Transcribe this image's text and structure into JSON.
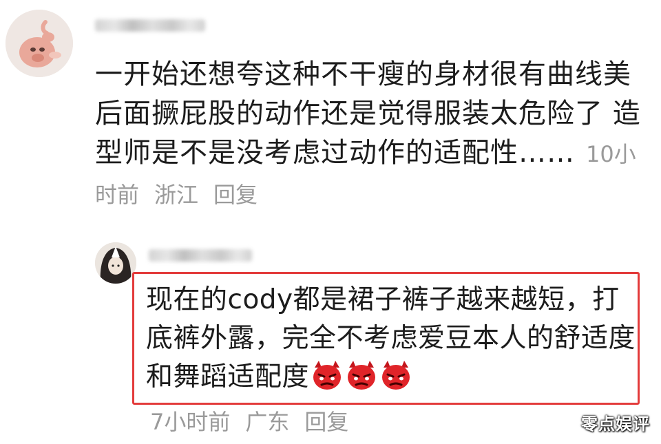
{
  "comments": [
    {
      "text": "一开始还想夸这种不干瘦的身材很有曲线美 后面撅屁股的动作还是觉得服装太危险了 造型师是不是没考虑过动作的适配性……",
      "time": "10小时前",
      "location": "浙江",
      "reply_label": "回复",
      "avatar_icon": "cartoon-pig-avatar-icon"
    },
    {
      "text": "现在的cody都是裙子裤子越来越短，打底裤外露，完全不考虑爱豆本人的舒适度和舞蹈适配度",
      "emoji_count": 3,
      "emoji_icon": "angry-devil-emoji-icon",
      "time": "7小时前",
      "location": "广东",
      "reply_label": "回复",
      "avatar_icon": "dark-hair-cartoon-avatar-icon",
      "highlight_color": "#e33b3b"
    }
  ],
  "watermark": "零点娱评"
}
